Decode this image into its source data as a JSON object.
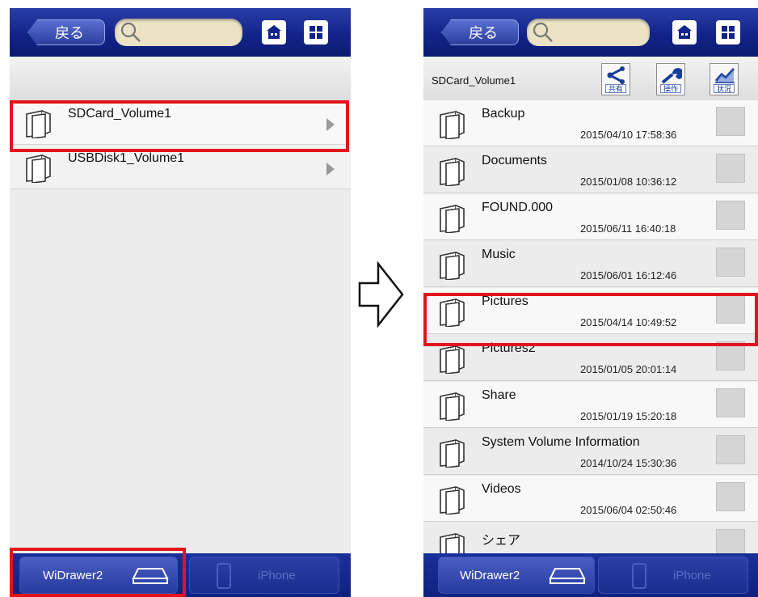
{
  "left_screen": {
    "back_label": "戻る",
    "folders": [
      {
        "name": "SDCard_Volume1"
      },
      {
        "name": "USBDisk1_Volume1"
      }
    ],
    "tabs": [
      {
        "label": "WiDrawer2"
      },
      {
        "label": "iPhone"
      }
    ]
  },
  "right_screen": {
    "back_label": "戻る",
    "volume_title": "SDCard_Volume1",
    "actions": [
      {
        "label": "共有",
        "icon": "share-icon"
      },
      {
        "label": "操作",
        "icon": "operation-icon"
      },
      {
        "label": "状況",
        "icon": "status-chart-icon"
      }
    ],
    "folders": [
      {
        "name": "Backup",
        "date": "2015/04/10 17:58:36"
      },
      {
        "name": "Documents",
        "date": "2015/01/08 10:36:12"
      },
      {
        "name": "FOUND.000",
        "date": "2015/06/11 16:40:18"
      },
      {
        "name": "Music",
        "date": "2015/06/01 16:12:46"
      },
      {
        "name": "Pictures",
        "date": "2015/04/14 10:49:52"
      },
      {
        "name": "Pictures2",
        "date": "2015/01/05 20:01:14"
      },
      {
        "name": "Share",
        "date": "2015/01/19 15:20:18"
      },
      {
        "name": "System Volume Information",
        "date": "2014/10/24 15:30:36"
      },
      {
        "name": "Videos",
        "date": "2015/06/04 02:50:46"
      },
      {
        "name": "シェア",
        "date": ""
      }
    ],
    "tabs": [
      {
        "label": "WiDrawer2"
      },
      {
        "label": "iPhone"
      }
    ]
  },
  "colors": {
    "topbar": "#12248a",
    "highlight": "#e2141b",
    "search_field": "#ece3c6"
  }
}
